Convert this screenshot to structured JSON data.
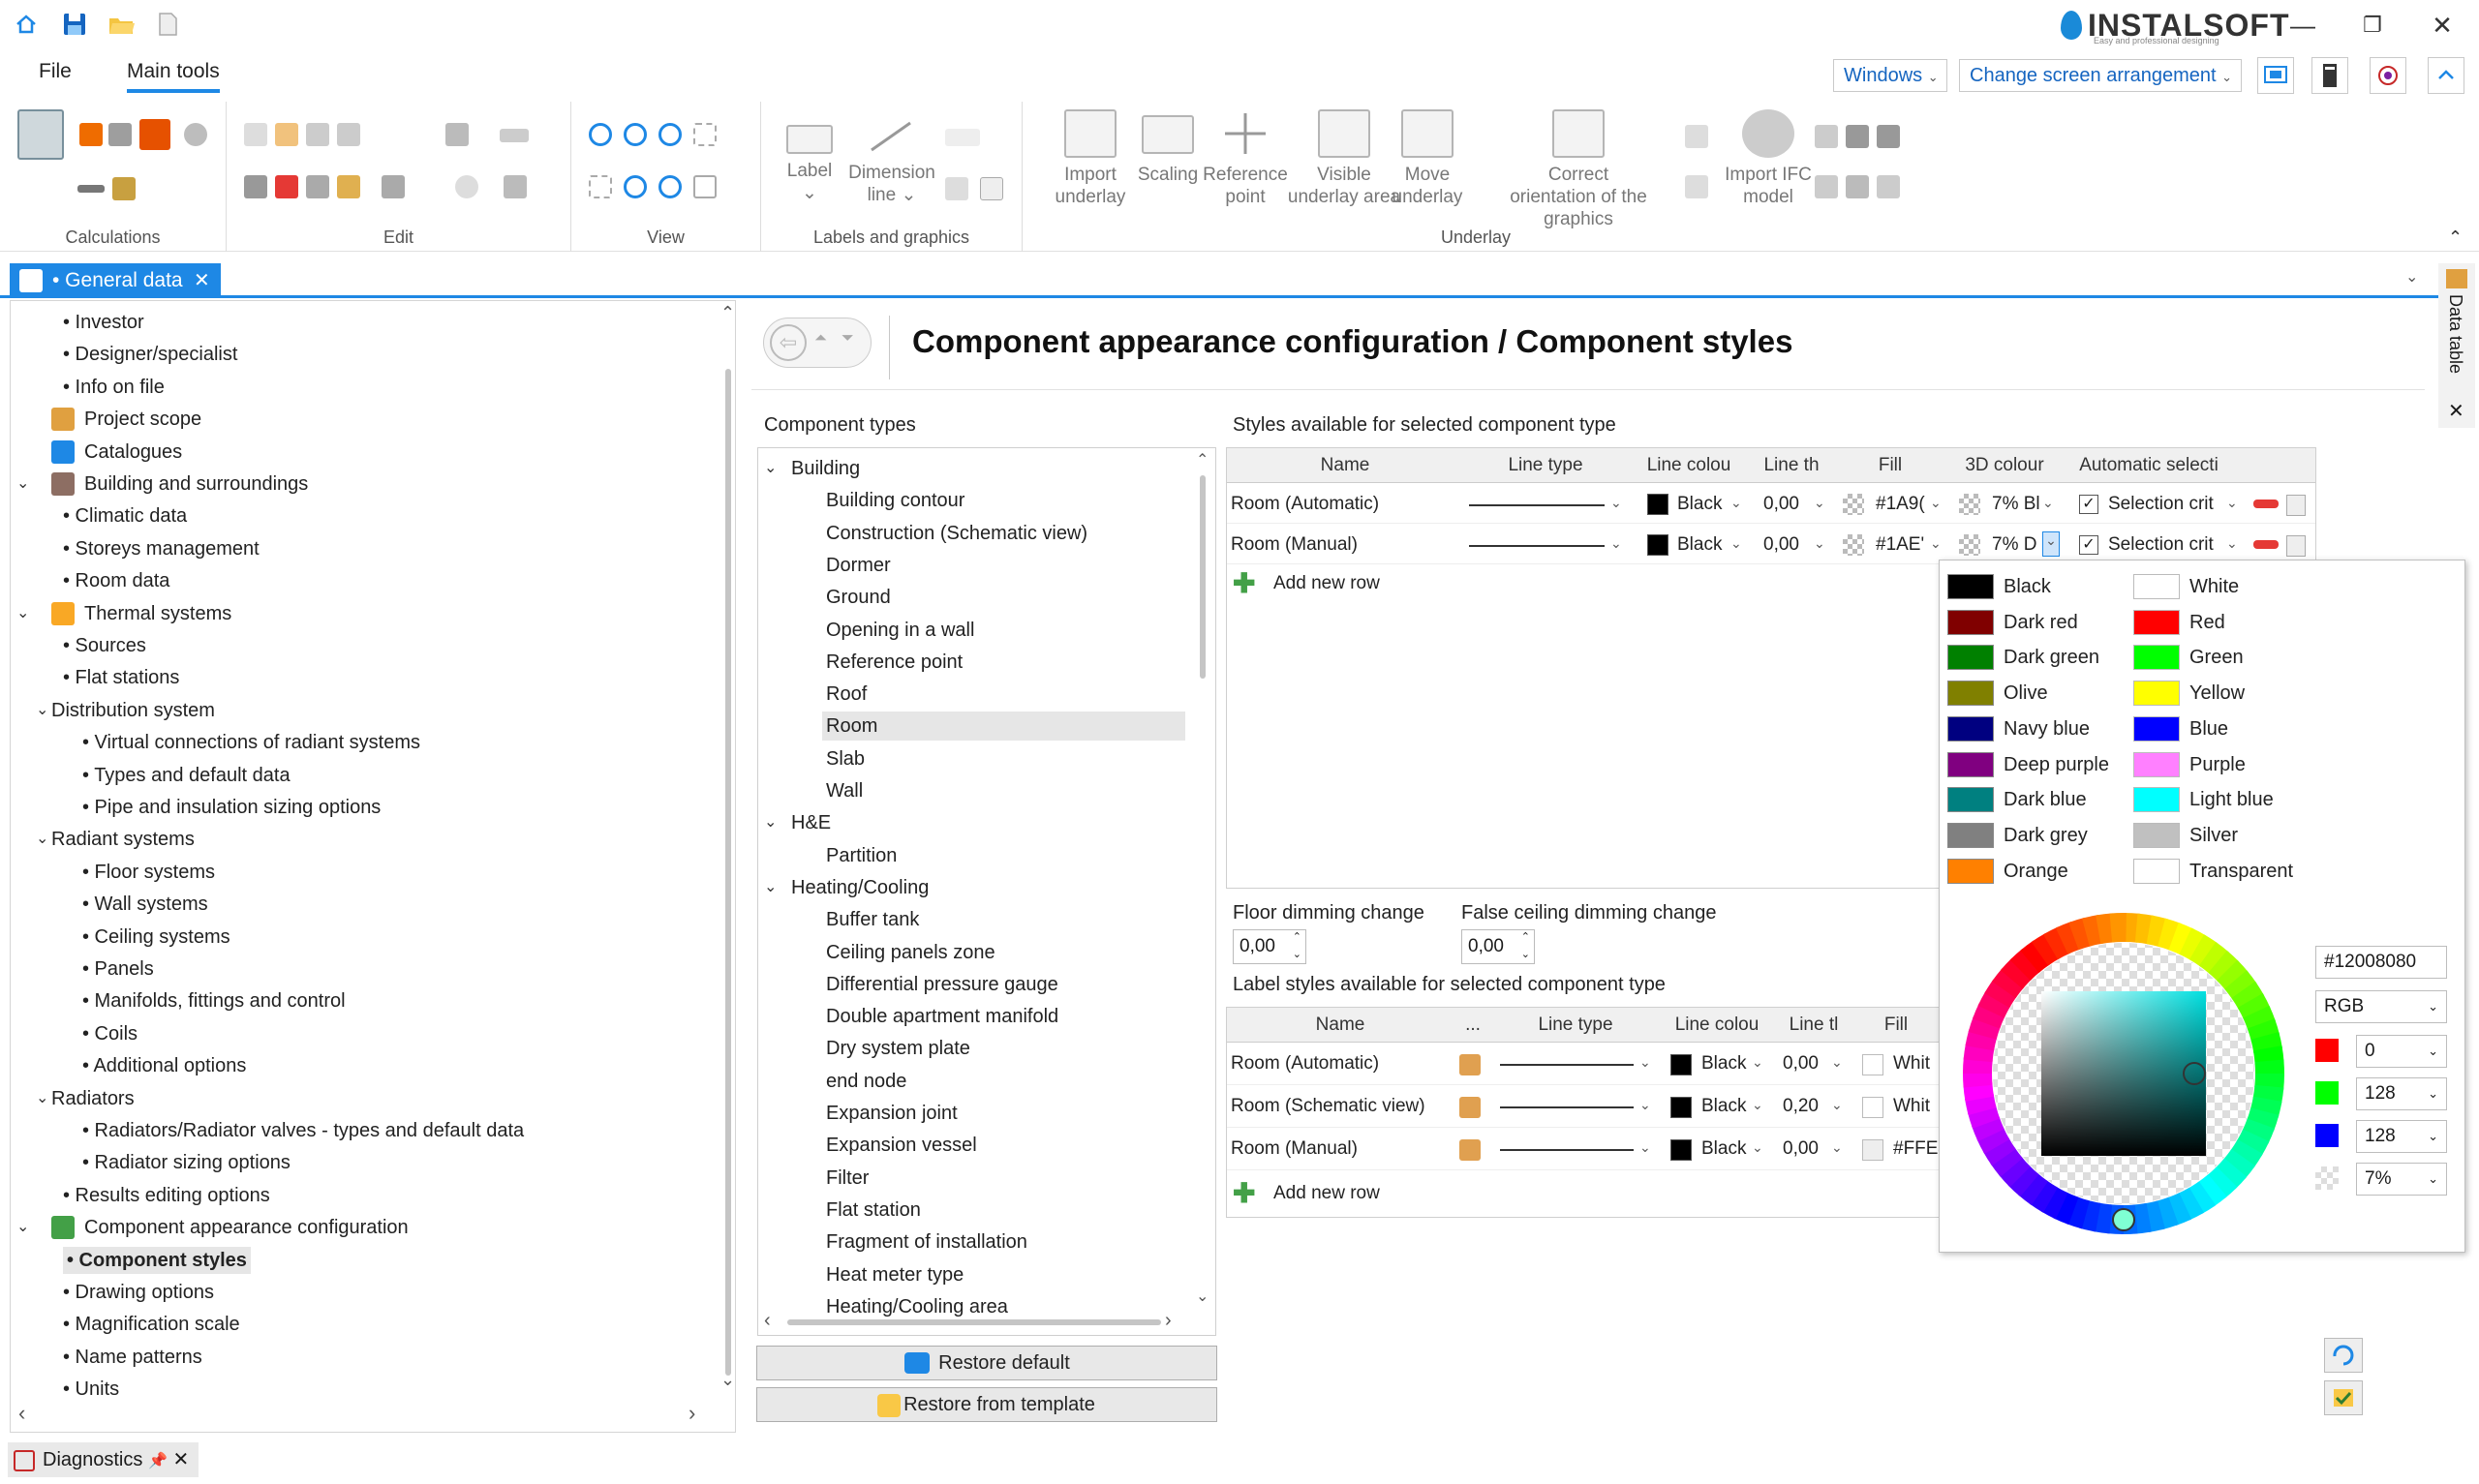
{
  "window": {
    "logo_text": "INSTALSOFT",
    "logo_sub": "Easy and professional designing"
  },
  "menu": {
    "file": "File",
    "main_tools": "Main tools"
  },
  "top_right": {
    "windows": "Windows",
    "arrangement": "Change screen arrangement"
  },
  "ribbon": {
    "groups": {
      "calculations": "Calculations",
      "edit": "Edit",
      "view": "View",
      "labels": "Labels and graphics",
      "underlay": "Underlay"
    },
    "buttons": {
      "label": "Label",
      "dimension_line": "Dimension line",
      "import_underlay": "Import underlay",
      "scaling": "Scaling",
      "reference_point": "Reference point",
      "visible_underlay_area": "Visible underlay area",
      "move_underlay": "Move underlay",
      "correct_orientation": "Correct orientation of the graphics",
      "import_ifc": "Import IFC model"
    }
  },
  "doc_tab": {
    "label": "• General data"
  },
  "side_panel": {
    "data_table": "Data table"
  },
  "tree": [
    {
      "label": "Investor",
      "level": 2
    },
    {
      "label": "Designer/specialist",
      "level": 2
    },
    {
      "label": "Info on file",
      "level": 2
    },
    {
      "label": "Project scope",
      "level": 1,
      "icon": "scope"
    },
    {
      "label": "Catalogues",
      "level": 1,
      "icon": "catalogue"
    },
    {
      "label": "Building and surroundings",
      "level": 1,
      "icon": "building",
      "expanded": true
    },
    {
      "label": "Climatic data",
      "level": 2
    },
    {
      "label": "Storeys management",
      "level": 2
    },
    {
      "label": "Room data",
      "level": 2
    },
    {
      "label": "Thermal systems",
      "level": 1,
      "icon": "thermal",
      "expanded": true
    },
    {
      "label": "Sources",
      "level": 2
    },
    {
      "label": "Flat stations",
      "level": 2
    },
    {
      "label": "Distribution system",
      "level": 2,
      "expanded": true,
      "node": true
    },
    {
      "label": "Virtual connections of radiant systems",
      "level": 3
    },
    {
      "label": "Types and default data",
      "level": 3
    },
    {
      "label": "Pipe and insulation sizing options",
      "level": 3
    },
    {
      "label": "Radiant systems",
      "level": 2,
      "expanded": true,
      "node": true
    },
    {
      "label": "Floor systems",
      "level": 3
    },
    {
      "label": "Wall systems",
      "level": 3
    },
    {
      "label": "Ceiling systems",
      "level": 3
    },
    {
      "label": "Panels",
      "level": 3
    },
    {
      "label": "Manifolds, fittings and control",
      "level": 3
    },
    {
      "label": "Coils",
      "level": 3
    },
    {
      "label": "Additional options",
      "level": 3
    },
    {
      "label": "Radiators",
      "level": 2,
      "expanded": true,
      "node": true
    },
    {
      "label": "Radiators/Radiator valves - types and default data",
      "level": 3
    },
    {
      "label": "Radiator sizing options",
      "level": 3
    },
    {
      "label": "Results editing options",
      "level": 2
    },
    {
      "label": "Component appearance configuration",
      "level": 1,
      "icon": "appearance",
      "expanded": true
    },
    {
      "label": "Component styles",
      "level": 2,
      "selected": true
    },
    {
      "label": "Drawing options",
      "level": 2
    },
    {
      "label": "Magnification scale",
      "level": 2
    },
    {
      "label": "Name patterns",
      "level": 2
    },
    {
      "label": "Units",
      "level": 2
    }
  ],
  "page": {
    "title": "Component appearance configuration / Component styles"
  },
  "component_types": {
    "label": "Component types",
    "items": [
      {
        "label": "Building",
        "group": true
      },
      {
        "label": "Building contour"
      },
      {
        "label": "Construction (Schematic view)"
      },
      {
        "label": "Dormer"
      },
      {
        "label": "Ground"
      },
      {
        "label": "Opening in a wall"
      },
      {
        "label": "Reference point"
      },
      {
        "label": "Roof"
      },
      {
        "label": "Room",
        "selected": true
      },
      {
        "label": "Slab"
      },
      {
        "label": "Wall"
      },
      {
        "label": "H&E",
        "group": true
      },
      {
        "label": "Partition"
      },
      {
        "label": "Heating/Cooling",
        "group": true
      },
      {
        "label": "Buffer tank"
      },
      {
        "label": "Ceiling panels zone"
      },
      {
        "label": "Differential pressure gauge"
      },
      {
        "label": "Double apartment manifold"
      },
      {
        "label": "Dry system plate"
      },
      {
        "label": "end node"
      },
      {
        "label": "Expansion joint"
      },
      {
        "label": "Expansion vessel"
      },
      {
        "label": "Filter"
      },
      {
        "label": "Flat station"
      },
      {
        "label": "Fragment of installation"
      },
      {
        "label": "Heat meter type"
      },
      {
        "label": "Heating/Cooling area"
      }
    ],
    "restore_default": "Restore default",
    "restore_template": "Restore from template"
  },
  "styles": {
    "label": "Styles available for selected component type",
    "columns": [
      "Name",
      "Line type",
      "Line colou",
      "Line th",
      "Fill",
      "3D colour",
      "Automatic selecti"
    ],
    "rows": [
      {
        "name": "Room (Automatic)",
        "line_colour": "Black",
        "line_th": "0,00",
        "fill": "#1A9(",
        "colour3d": "7% Bl",
        "auto": "Selection crit"
      },
      {
        "name": "Room (Manual)",
        "line_colour": "Black",
        "line_th": "0,00",
        "fill": "#1AE'",
        "colour3d": "7% D",
        "auto": "Selection crit"
      }
    ],
    "add_row": "Add new row"
  },
  "dimming": {
    "floor_label": "Floor dimming change",
    "floor_value": "0,00",
    "ceiling_label": "False ceiling dimming change",
    "ceiling_value": "0,00"
  },
  "label_styles": {
    "label": "Label styles available for selected component type",
    "columns": [
      "Name",
      "...",
      "Line type",
      "Line colou",
      "Line tl",
      "Fill"
    ],
    "rows": [
      {
        "name": "Room (Automatic)",
        "line_colour": "Black",
        "line_th": "0,00",
        "fill": "Whit"
      },
      {
        "name": "Room (Schematic view)",
        "line_colour": "Black",
        "line_th": "0,20",
        "fill": "Whit"
      },
      {
        "name": "Room (Manual)",
        "line_colour": "Black",
        "line_th": "0,00",
        "fill": "#FFE4"
      }
    ],
    "add_row": "Add new row"
  },
  "color_popup": {
    "left": [
      {
        "name": "Black",
        "color": "#000000"
      },
      {
        "name": "Dark red",
        "color": "#800000"
      },
      {
        "name": "Dark green",
        "color": "#008000"
      },
      {
        "name": "Olive",
        "color": "#808000"
      },
      {
        "name": "Navy blue",
        "color": "#000080"
      },
      {
        "name": "Deep purple",
        "color": "#800080"
      },
      {
        "name": "Dark blue",
        "color": "#008080"
      },
      {
        "name": "Dark grey",
        "color": "#808080"
      },
      {
        "name": "Orange",
        "color": "#ff8000"
      }
    ],
    "right": [
      {
        "name": "White",
        "color": "#ffffff"
      },
      {
        "name": "Red",
        "color": "#ff0000"
      },
      {
        "name": "Green",
        "color": "#00ff00"
      },
      {
        "name": "Yellow",
        "color": "#ffff00"
      },
      {
        "name": "Blue",
        "color": "#0000ff"
      },
      {
        "name": "Purple",
        "color": "#ff80ff"
      },
      {
        "name": "Light blue",
        "color": "#00ffff"
      },
      {
        "name": "Silver",
        "color": "#c0c0c0"
      },
      {
        "name": "Transparent",
        "color": "#ffffff"
      }
    ],
    "hex": "#12008080",
    "mode": "RGB",
    "r": "0",
    "g": "128",
    "b": "128",
    "alpha": "7%"
  },
  "bottom": {
    "diagnostics": "Diagnostics"
  }
}
